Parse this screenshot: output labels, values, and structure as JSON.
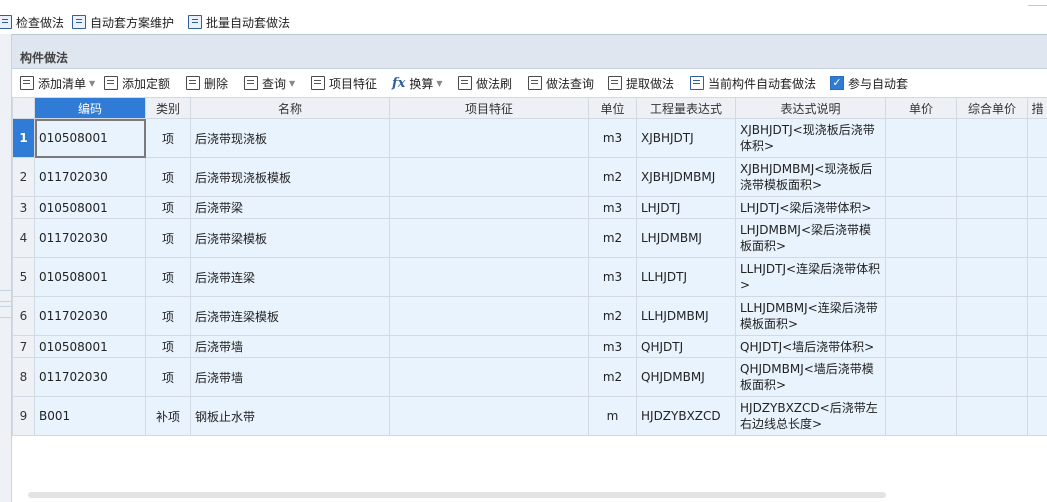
{
  "top_toolbar": {
    "check_method": "检查做法",
    "auto_plan_maintain": "自动套方案维护",
    "batch_auto_apply": "批量自动套做法"
  },
  "panel": {
    "title": "构件做法"
  },
  "toolbar": {
    "add_list": "添加清单",
    "add_quota": "添加定额",
    "delete": "删除",
    "query": "查询",
    "item_feature": "项目特征",
    "convert": "换算",
    "method_brush": "做法刷",
    "method_query": "做法查询",
    "extract_method": "提取做法",
    "current_auto_apply": "当前构件自动套做法",
    "join_auto_apply": "参与自动套",
    "join_auto_apply_checked": true
  },
  "table": {
    "columns": [
      "编码",
      "类别",
      "名称",
      "项目特征",
      "单位",
      "工程量表达式",
      "表达式说明",
      "单价",
      "综合单价",
      "措"
    ],
    "rows": [
      {
        "num": "1",
        "code": "010508001",
        "type": "项",
        "name": "后浇带现浇板",
        "feature": "",
        "unit": "m3",
        "expr": "XJBHJDTJ",
        "desc": "XJBHJDTJ<现浇板后浇带体积>",
        "price": "",
        "total": ""
      },
      {
        "num": "2",
        "code": "011702030",
        "type": "项",
        "name": "后浇带现浇板模板",
        "feature": "",
        "unit": "m2",
        "expr": "XJBHJDMBMJ",
        "desc": "XJBHJDMBMJ<现浇板后浇带模板面积>",
        "price": "",
        "total": ""
      },
      {
        "num": "3",
        "code": "010508001",
        "type": "项",
        "name": "后浇带梁",
        "feature": "",
        "unit": "m3",
        "expr": "LHJDTJ",
        "desc": "LHJDTJ<梁后浇带体积>",
        "price": "",
        "total": ""
      },
      {
        "num": "4",
        "code": "011702030",
        "type": "项",
        "name": "后浇带梁模板",
        "feature": "",
        "unit": "m2",
        "expr": "LHJDMBMJ",
        "desc": "LHJDMBMJ<梁后浇带模板面积>",
        "price": "",
        "total": ""
      },
      {
        "num": "5",
        "code": "010508001",
        "type": "项",
        "name": "后浇带连梁",
        "feature": "",
        "unit": "m3",
        "expr": "LLHJDTJ",
        "desc": "LLHJDTJ<连梁后浇带体积>",
        "price": "",
        "total": ""
      },
      {
        "num": "6",
        "code": "011702030",
        "type": "项",
        "name": "后浇带连梁模板",
        "feature": "",
        "unit": "m2",
        "expr": "LLHJDMBMJ",
        "desc": "LLHJDMBMJ<连梁后浇带模板面积>",
        "price": "",
        "total": ""
      },
      {
        "num": "7",
        "code": "010508001",
        "type": "项",
        "name": "后浇带墙",
        "feature": "",
        "unit": "m3",
        "expr": "QHJDTJ",
        "desc": "QHJDTJ<墙后浇带体积>",
        "price": "",
        "total": ""
      },
      {
        "num": "8",
        "code": "011702030",
        "type": "项",
        "name": "后浇带墙",
        "feature": "",
        "unit": "m2",
        "expr": "QHJDMBMJ",
        "desc": "QHJDMBMJ<墙后浇带模板面积>",
        "price": "",
        "total": ""
      },
      {
        "num": "9",
        "code": "B001",
        "type": "补项",
        "name": "钢板止水带",
        "feature": "",
        "unit": "m",
        "expr": "HJDZYBXZCD",
        "desc": "HJDZYBXZCD<后浇带左右边线总长度>",
        "price": "",
        "total": ""
      }
    ]
  },
  "colors": {
    "selection": "#2f7bd6",
    "row_bg": "#e8f3fd",
    "header_bg": "#edf1f6",
    "panel_header_bg": "#dfe6ef"
  }
}
